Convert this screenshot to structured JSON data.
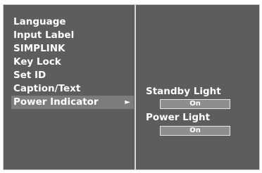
{
  "menu": {
    "items": [
      {
        "label": "Language"
      },
      {
        "label": "Input Label"
      },
      {
        "label": "SIMPLINK"
      },
      {
        "label": "Key Lock"
      },
      {
        "label": "Set ID"
      },
      {
        "label": "Caption/Text"
      },
      {
        "label": "Power Indicator",
        "arrow": "►"
      }
    ]
  },
  "submenu": {
    "standby_light_label": "Standby Light",
    "standby_light_value": "On",
    "power_light_label": "Power Light",
    "power_light_value": "On"
  },
  "colors": {
    "panel_bg": "#5d5d5d",
    "highlight_bg": "#7c7c7c",
    "value_box_bg": "#8e8e8e",
    "text": "#ffffff"
  }
}
